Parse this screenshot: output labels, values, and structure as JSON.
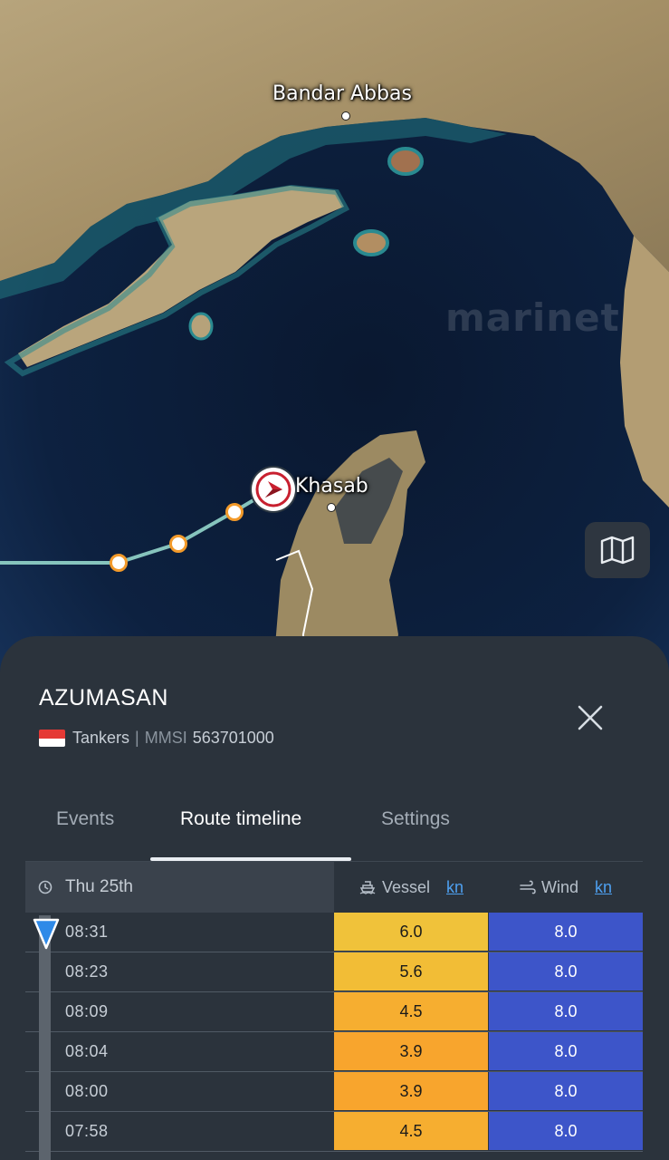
{
  "map": {
    "labels": {
      "bandar_abbas": "Bandar Abbas",
      "khasab": "Khasab"
    },
    "watermark": "marinet",
    "map_layers_icon": "map-icon",
    "vessel_icon": "vessel-heading-icon"
  },
  "vessel": {
    "name": "AZUMASAN",
    "type": "Tankers",
    "mmsi_label": "MMSI",
    "mmsi": "563701000",
    "flag_icon": "singapore-flag-icon"
  },
  "tabs": [
    {
      "label": "Events",
      "active": false
    },
    {
      "label": "Route timeline",
      "active": true
    },
    {
      "label": "Settings",
      "active": false
    }
  ],
  "table": {
    "date": "Thu 25th",
    "vessel_label": "Vessel",
    "wind_label": "Wind",
    "unit": "kn",
    "rows": [
      {
        "time": "08:31",
        "vessel": "6.0",
        "wind": "8.0",
        "color": "#f0c23a"
      },
      {
        "time": "08:23",
        "vessel": "5.6",
        "wind": "8.0",
        "color": "#f2bd36"
      },
      {
        "time": "08:09",
        "vessel": "4.5",
        "wind": "8.0",
        "color": "#f6ae30"
      },
      {
        "time": "08:04",
        "vessel": "3.9",
        "wind": "8.0",
        "color": "#f8a52d"
      },
      {
        "time": "08:00",
        "vessel": "3.9",
        "wind": "8.0",
        "color": "#f8a52d"
      },
      {
        "time": "07:58",
        "vessel": "4.5",
        "wind": "8.0",
        "color": "#f6ae30"
      }
    ]
  },
  "colors": {
    "panel": "#2b333c",
    "wind_cell": "#3d55c9",
    "accent": "#4ea0f0",
    "route": "#86c4bd",
    "waypoint": "#f39a2a"
  }
}
